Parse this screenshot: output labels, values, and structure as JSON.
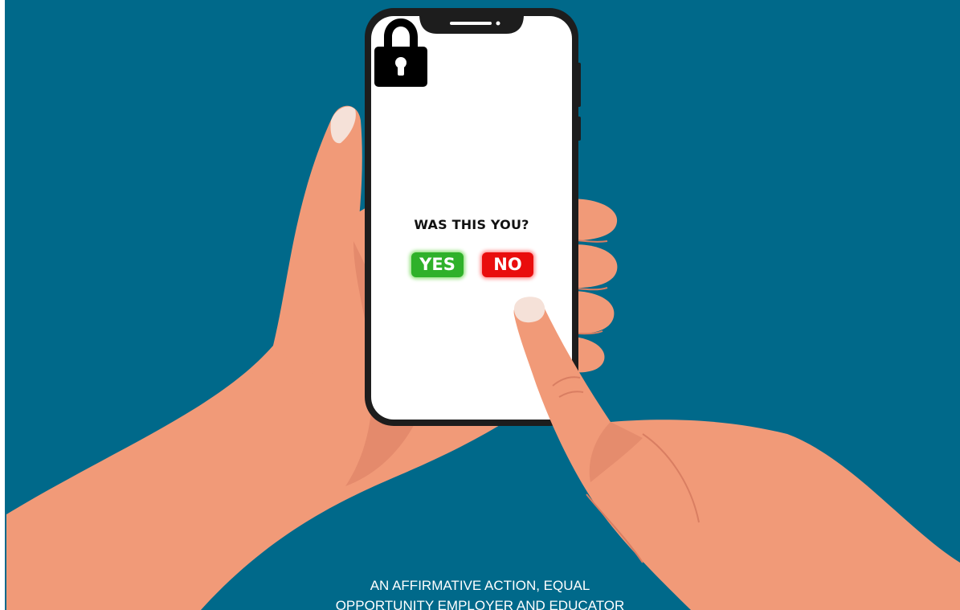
{
  "colors": {
    "background": "#00698a",
    "skin": "#f19a78",
    "skin_shadow": "#d97e62",
    "nail": "#f5e1d8",
    "phone_frame": "#1d1d1d",
    "screen": "#ffffff",
    "yes": "#2fb12a",
    "no": "#e90d0d"
  },
  "phone": {
    "icon": "padlock-icon",
    "question": "WAS THIS YOU?",
    "yes_label": "YES",
    "no_label": "NO"
  },
  "footer": {
    "line1": "AN AFFIRMATIVE ACTION, EQUAL",
    "line2": "OPPORTUNITY EMPLOYER AND EDUCATOR"
  }
}
